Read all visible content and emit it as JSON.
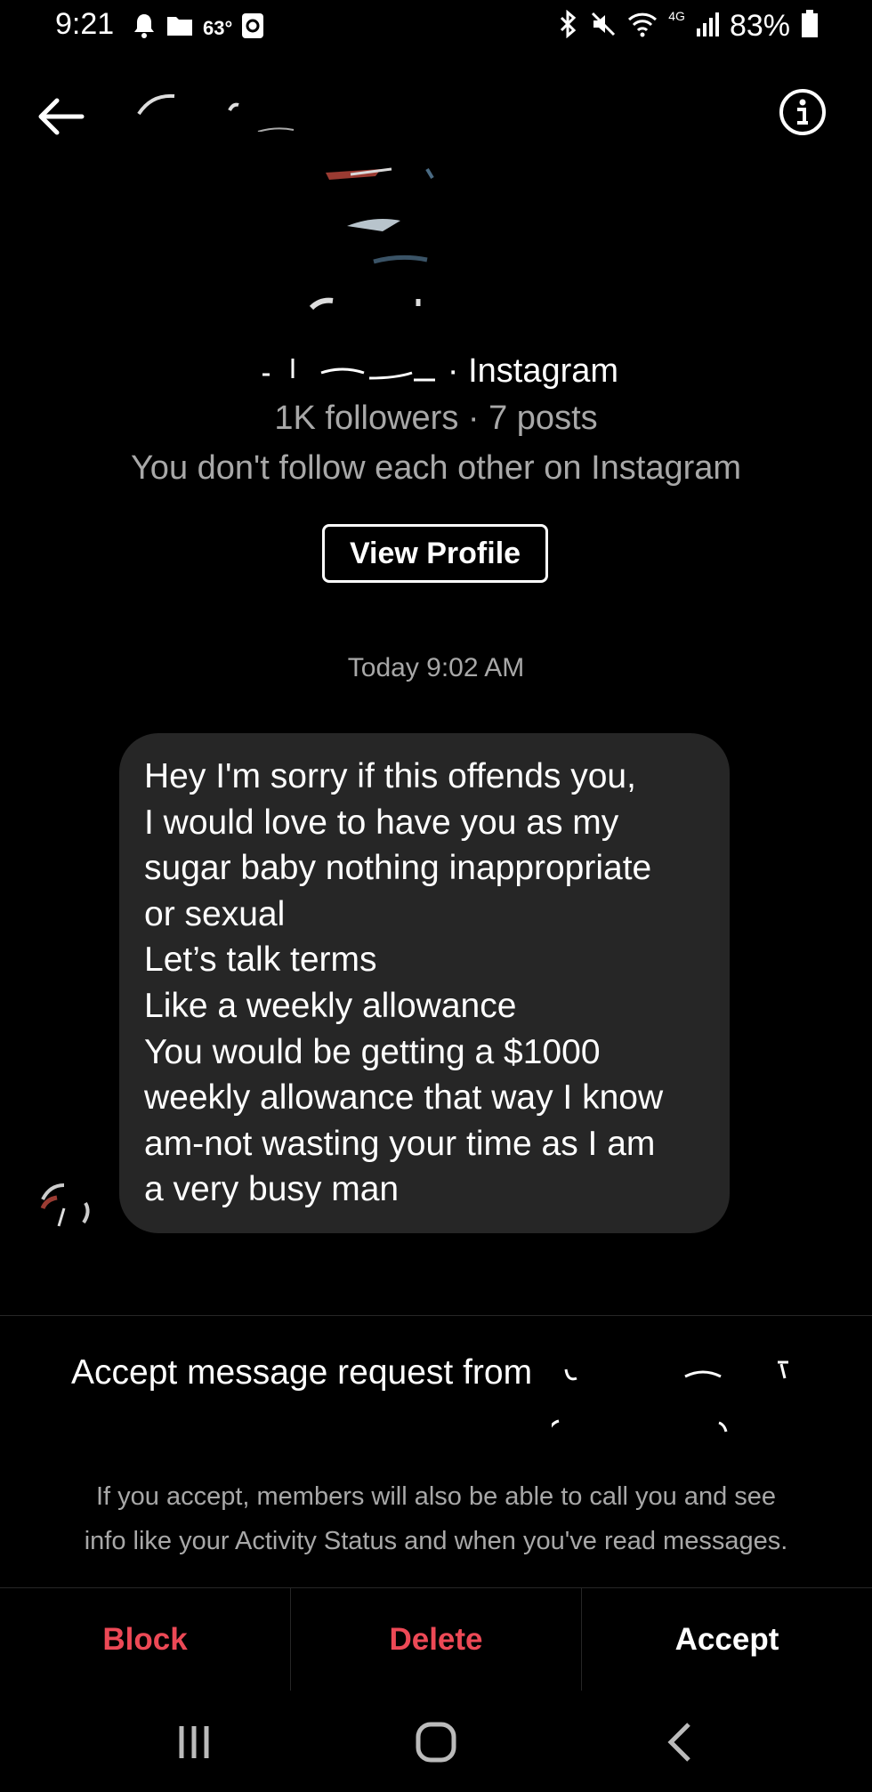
{
  "status_bar": {
    "time": "9:21",
    "temperature": "63°",
    "battery": "83%",
    "network": "4G",
    "icons": [
      "bell-icon",
      "folder-icon",
      "app-icon",
      "bluetooth-icon",
      "mute-icon",
      "wifi-icon",
      "signal-icon",
      "battery-icon"
    ]
  },
  "header": {
    "back_icon": "back-arrow-icon",
    "info_icon": "info-icon"
  },
  "profile": {
    "suffix": "· Instagram",
    "stats": "1K followers · 7 posts",
    "relationship": "You don't follow each other on Instagram",
    "view_profile_label": "View Profile"
  },
  "conversation": {
    "timestamp": "Today 9:02 AM",
    "message_lines": [
      "Hey I'm sorry if this offends you,",
      "I would love to have you as my",
      "sugar baby nothing inappropriate",
      "or sexual",
      "Let’s talk terms",
      "Like a weekly allowance",
      "You would be getting a $1000",
      "weekly allowance that way I know",
      "am-not wasting your time as I am",
      "a very busy man"
    ]
  },
  "request": {
    "title": "Accept message request from",
    "info_line1": "If you accept, members will also be able to call you and see",
    "info_line2": "info like your Activity Status and when you've read messages."
  },
  "actions": {
    "block_label": "Block",
    "delete_label": "Delete",
    "accept_label": "Accept",
    "destructive_color": "#ed4956",
    "accept_color": "#ffffff"
  },
  "nav": {
    "icons": [
      "recent-apps-icon",
      "home-icon",
      "back-icon"
    ]
  }
}
